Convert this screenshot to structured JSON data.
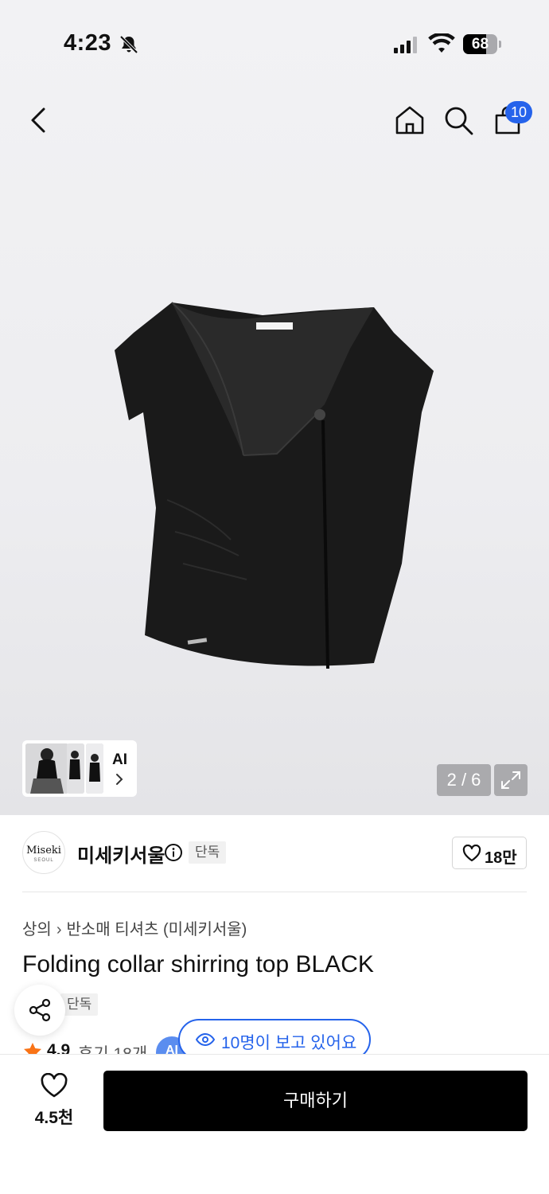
{
  "status_bar": {
    "time": "4:23",
    "battery_percent": "68",
    "battery_level": 0.68
  },
  "nav": {
    "cart_count": "10",
    "icons": [
      "back-icon",
      "home-icon",
      "search-icon",
      "shopping-bag-icon"
    ]
  },
  "gallery": {
    "ai_label": "AI",
    "counter": "2 / 6"
  },
  "brand": {
    "logo_text": "Miseki",
    "logo_subtext": "SEOUL",
    "name": "미세키서울",
    "tag": "단독",
    "follow_count": "18만"
  },
  "product": {
    "breadcrumb": [
      "상의",
      "반소매 티셔츠 (미세키서울)"
    ],
    "title": "Folding collar shirring top BLACK",
    "tag": "단독",
    "rating": "4.9",
    "reviews": "후기 18개",
    "ai_chip": "AI"
  },
  "viewers": {
    "text": "10명이 보고 있어요"
  },
  "bottom_bar": {
    "like_count": "4.5천",
    "buy_label": "구매하기"
  },
  "colors": {
    "accent": "#2563eb",
    "buy_button": "#000000",
    "rating_star": "#f97316"
  }
}
